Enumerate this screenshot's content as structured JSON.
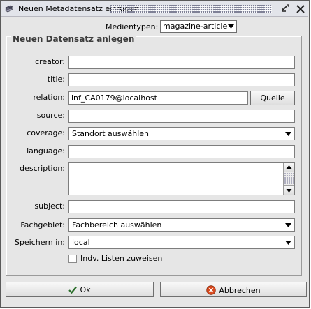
{
  "window": {
    "title": "Neuen Metadatensatz einfügen"
  },
  "media_type": {
    "label": "Medientypen:",
    "selected": "magazine-article"
  },
  "group": {
    "title": "Neuen Datensatz anlegen"
  },
  "fields": {
    "creator": {
      "label": "creator:",
      "value": ""
    },
    "title": {
      "label": "title:",
      "value": ""
    },
    "relation": {
      "label": "relation:",
      "value": "inf_CA0179@localhost",
      "button": "Quelle"
    },
    "source": {
      "label": "source:",
      "value": ""
    },
    "coverage": {
      "label": "coverage:",
      "selected": "Standort auswählen"
    },
    "language": {
      "label": "language:",
      "value": ""
    },
    "description": {
      "label": "description:",
      "value": ""
    },
    "subject": {
      "label": "subject:",
      "value": ""
    },
    "fachgebiet": {
      "label": "Fachgebiet:",
      "selected": "Fachbereich auswählen"
    },
    "speichern": {
      "label": "Speichern in:",
      "selected": "local"
    }
  },
  "checkbox": {
    "label": "Indv. Listen zuweisen",
    "checked": false
  },
  "buttons": {
    "ok": "Ok",
    "cancel": "Abbrechen"
  },
  "icons": {
    "app": "document-stack-icon",
    "restore": "restore-window-icon",
    "close": "close-icon",
    "ok": "checkmark-icon",
    "cancel": "cancel-circle-icon"
  },
  "colors": {
    "title_bar": "#e2e4ea",
    "dialog_bg": "#e6e6e6",
    "cancel_icon": "#d84a1f",
    "ok_icon": "#2a6e2a"
  }
}
